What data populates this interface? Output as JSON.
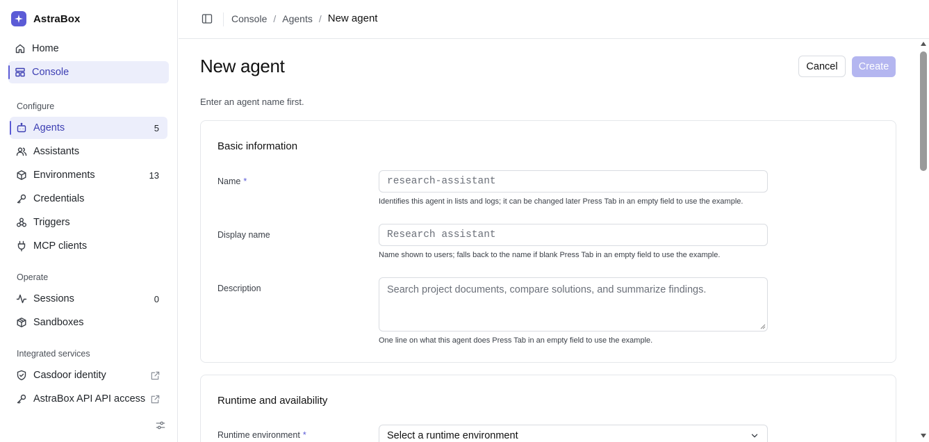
{
  "brand": {
    "name": "AstraBox",
    "accent": "#5b5bd6"
  },
  "sidebar": {
    "top_items": [
      {
        "label": "Home",
        "icon": "home-icon"
      },
      {
        "label": "Console",
        "icon": "console-icon"
      }
    ],
    "configure_label": "Configure",
    "configure_items": [
      {
        "label": "Agents",
        "icon": "bot-icon",
        "count": "5"
      },
      {
        "label": "Assistants",
        "icon": "users-icon",
        "count": ""
      },
      {
        "label": "Environments",
        "icon": "cube-icon",
        "count": "13"
      },
      {
        "label": "Credentials",
        "icon": "key-icon",
        "count": ""
      },
      {
        "label": "Triggers",
        "icon": "webhook-icon",
        "count": ""
      },
      {
        "label": "MCP clients",
        "icon": "plug-icon",
        "count": ""
      }
    ],
    "operate_label": "Operate",
    "operate_items": [
      {
        "label": "Sessions",
        "icon": "activity-icon",
        "count": "0"
      },
      {
        "label": "Sandboxes",
        "icon": "box-icon",
        "count": ""
      }
    ],
    "integrated_label": "Integrated services",
    "integrated_items": [
      {
        "label": "Casdoor identity",
        "icon": "shield-icon"
      },
      {
        "label": "AstraBox API API access",
        "icon": "key-icon"
      }
    ]
  },
  "breadcrumb": {
    "items": [
      "Console",
      "Agents"
    ],
    "current": "New agent"
  },
  "page": {
    "title": "New agent",
    "cancel_label": "Cancel",
    "create_label": "Create",
    "hint": "Enter an agent name first."
  },
  "basic": {
    "title": "Basic information",
    "name_label": "Name",
    "name_required": "*",
    "name_placeholder": "research-assistant",
    "name_help": "Identifies this agent in lists and logs; it can be changed later Press Tab in an empty field to use the example.",
    "display_label": "Display name",
    "display_placeholder": "Research assistant",
    "display_help": "Name shown to users; falls back to the name if blank Press Tab in an empty field to use the example.",
    "description_label": "Description",
    "description_placeholder": "Search project documents, compare solutions, and summarize findings.",
    "description_help": "One line on what this agent does Press Tab in an empty field to use the example."
  },
  "runtime": {
    "title": "Runtime and availability",
    "env_label": "Runtime environment",
    "env_required": "*",
    "env_value": "Select a runtime environment"
  }
}
